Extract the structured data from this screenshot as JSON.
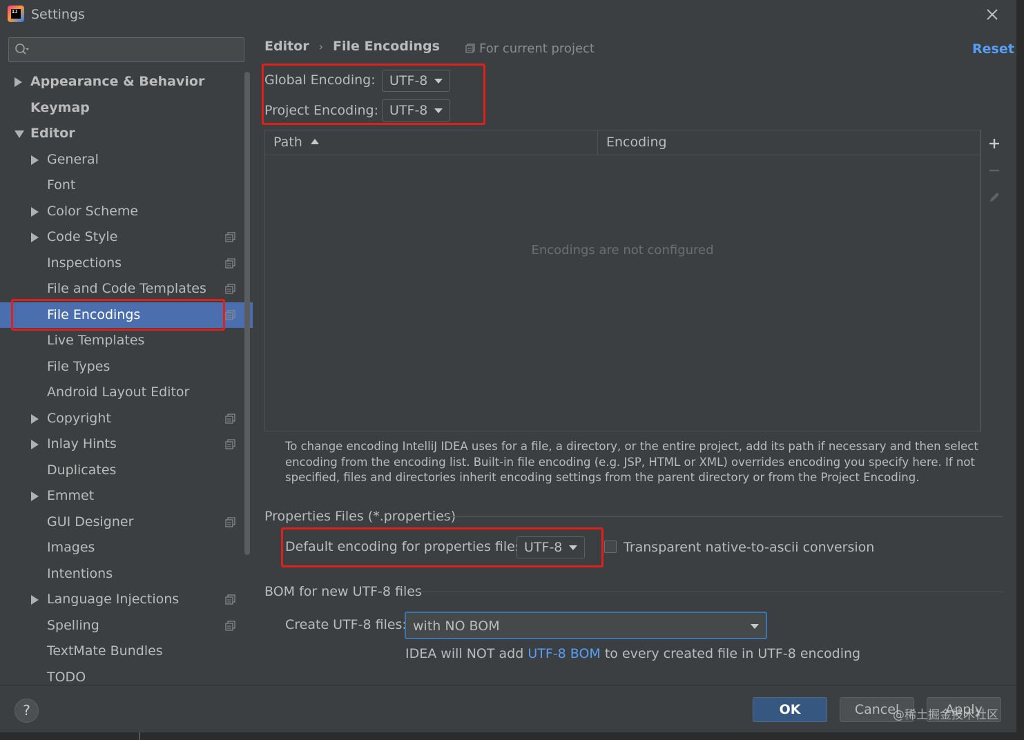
{
  "window": {
    "title": "Settings"
  },
  "search": {
    "placeholder": ""
  },
  "sidebar": {
    "items": [
      {
        "label": "Appearance & Behavior",
        "level": 0,
        "arrow": "right",
        "bold": true,
        "project_icon": false,
        "selected": false
      },
      {
        "label": "Keymap",
        "level": 0,
        "arrow": "none",
        "bold": true,
        "project_icon": false,
        "selected": false
      },
      {
        "label": "Editor",
        "level": 0,
        "arrow": "down",
        "bold": true,
        "project_icon": false,
        "selected": false
      },
      {
        "label": "General",
        "level": 1,
        "arrow": "right",
        "bold": false,
        "project_icon": false,
        "selected": false
      },
      {
        "label": "Font",
        "level": 1,
        "arrow": "none",
        "bold": false,
        "project_icon": false,
        "selected": false
      },
      {
        "label": "Color Scheme",
        "level": 1,
        "arrow": "right",
        "bold": false,
        "project_icon": false,
        "selected": false
      },
      {
        "label": "Code Style",
        "level": 1,
        "arrow": "right",
        "bold": false,
        "project_icon": true,
        "selected": false
      },
      {
        "label": "Inspections",
        "level": 1,
        "arrow": "none",
        "bold": false,
        "project_icon": true,
        "selected": false
      },
      {
        "label": "File and Code Templates",
        "level": 1,
        "arrow": "none",
        "bold": false,
        "project_icon": true,
        "selected": false
      },
      {
        "label": "File Encodings",
        "level": 1,
        "arrow": "none",
        "bold": false,
        "project_icon": true,
        "selected": true
      },
      {
        "label": "Live Templates",
        "level": 1,
        "arrow": "none",
        "bold": false,
        "project_icon": false,
        "selected": false
      },
      {
        "label": "File Types",
        "level": 1,
        "arrow": "none",
        "bold": false,
        "project_icon": false,
        "selected": false
      },
      {
        "label": "Android Layout Editor",
        "level": 1,
        "arrow": "none",
        "bold": false,
        "project_icon": false,
        "selected": false
      },
      {
        "label": "Copyright",
        "level": 1,
        "arrow": "right",
        "bold": false,
        "project_icon": true,
        "selected": false
      },
      {
        "label": "Inlay Hints",
        "level": 1,
        "arrow": "right",
        "bold": false,
        "project_icon": true,
        "selected": false
      },
      {
        "label": "Duplicates",
        "level": 1,
        "arrow": "none",
        "bold": false,
        "project_icon": false,
        "selected": false
      },
      {
        "label": "Emmet",
        "level": 1,
        "arrow": "right",
        "bold": false,
        "project_icon": false,
        "selected": false
      },
      {
        "label": "GUI Designer",
        "level": 1,
        "arrow": "none",
        "bold": false,
        "project_icon": true,
        "selected": false
      },
      {
        "label": "Images",
        "level": 1,
        "arrow": "none",
        "bold": false,
        "project_icon": false,
        "selected": false
      },
      {
        "label": "Intentions",
        "level": 1,
        "arrow": "none",
        "bold": false,
        "project_icon": false,
        "selected": false
      },
      {
        "label": "Language Injections",
        "level": 1,
        "arrow": "right",
        "bold": false,
        "project_icon": true,
        "selected": false
      },
      {
        "label": "Spelling",
        "level": 1,
        "arrow": "none",
        "bold": false,
        "project_icon": true,
        "selected": false
      },
      {
        "label": "TextMate Bundles",
        "level": 1,
        "arrow": "none",
        "bold": false,
        "project_icon": false,
        "selected": false
      },
      {
        "label": "TODO",
        "level": 1,
        "arrow": "none",
        "bold": false,
        "project_icon": false,
        "selected": false
      }
    ]
  },
  "header": {
    "breadcrumb": [
      "Editor",
      "File Encodings"
    ],
    "for_current_project": "For current project",
    "reset": "Reset"
  },
  "encodings": {
    "global_label": "Global Encoding:",
    "global_value": "UTF-8",
    "project_label": "Project Encoding:",
    "project_value": "UTF-8"
  },
  "table": {
    "columns": [
      "Path",
      "Encoding"
    ],
    "sort_column": "Path",
    "sort_direction": "ascending",
    "empty_text": "Encodings are not configured",
    "tools": [
      "add-icon",
      "remove-icon",
      "edit-icon"
    ]
  },
  "help_text": "To change encoding IntelliJ IDEA uses for a file, a directory, or the entire project, add its path if necessary and then select encoding from the encoding list. Built-in file encoding (e.g. JSP, HTML or XML) overrides encoding you specify here. If not specified, files and directories inherit encoding settings from the parent directory or from the Project Encoding.",
  "properties": {
    "section_title": "Properties Files (*.properties)",
    "default_label": "Default encoding for properties files:",
    "default_value": "UTF-8",
    "transparent_label": "Transparent native-to-ascii conversion",
    "transparent_checked": false
  },
  "bom": {
    "section_title": "BOM for new UTF-8 files",
    "create_label": "Create UTF-8 files:",
    "create_value": "with NO BOM",
    "note_prefix": "IDEA will NOT add ",
    "note_link": "UTF-8 BOM",
    "note_suffix": " to every created file in UTF-8 encoding"
  },
  "footer": {
    "help": "?",
    "ok": "OK",
    "cancel": "Cancel",
    "apply": "Apply",
    "watermark": "@稀土掘金技术社区"
  },
  "colors": {
    "background": "#3c3f41",
    "selection": "#4b6eaf",
    "link": "#589df6",
    "highlight_box": "#e0201b",
    "ok_button": "#365880"
  }
}
